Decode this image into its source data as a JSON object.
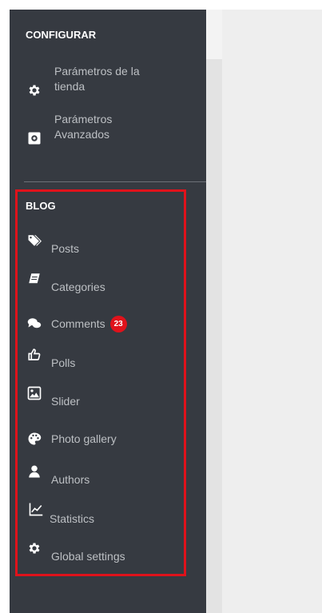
{
  "configurar": {
    "title": "CONFIGURAR",
    "items": [
      {
        "label": "Parámetros de la tienda",
        "icon": "gear-icon"
      },
      {
        "label": "Parámetros Avanzados",
        "icon": "settings-box-icon"
      }
    ]
  },
  "blog": {
    "title": "BLOG",
    "items": [
      {
        "label": "Posts",
        "icon": "tags-icon"
      },
      {
        "label": "Categories",
        "icon": "book-icon"
      },
      {
        "label": "Comments",
        "icon": "comments-icon",
        "badge": "23"
      },
      {
        "label": "Polls",
        "icon": "thumbs-up-icon"
      },
      {
        "label": "Slider",
        "icon": "image-icon"
      },
      {
        "label": "Photo gallery",
        "icon": "palette-icon"
      },
      {
        "label": "Authors",
        "icon": "user-icon"
      },
      {
        "label": "Statistics",
        "icon": "line-chart-icon"
      },
      {
        "label": "Global settings",
        "icon": "gear-icon"
      }
    ]
  },
  "colors": {
    "sidebar_bg": "#363a41",
    "highlight": "#e0121b",
    "badge": "#e0121b"
  }
}
